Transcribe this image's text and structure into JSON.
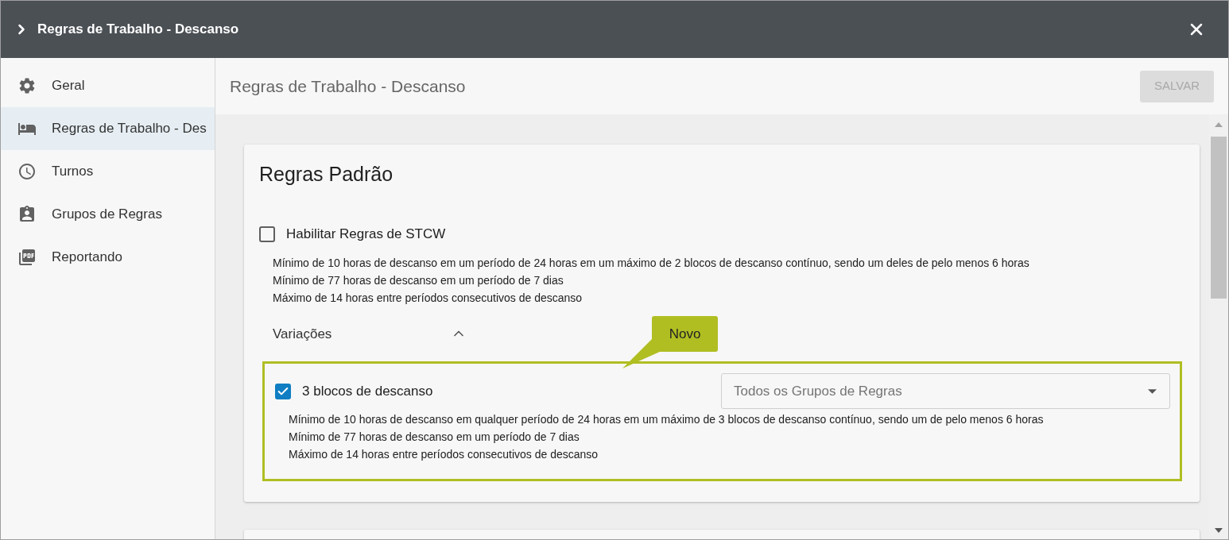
{
  "window": {
    "title": "Regras de Trabalho - Descanso"
  },
  "sidebar": {
    "items": [
      {
        "label": "Geral",
        "selected": false
      },
      {
        "label": "Regras de Trabalho - Des",
        "selected": true
      },
      {
        "label": "Turnos",
        "selected": false
      },
      {
        "label": "Grupos de Regras",
        "selected": false
      },
      {
        "label": "Reportando",
        "selected": false
      }
    ]
  },
  "page": {
    "title": "Regras de Trabalho - Descanso",
    "save_button": {
      "label": "SALVAR",
      "disabled": true
    }
  },
  "card": {
    "title": "Regras Padrão",
    "main_rule": {
      "label": "Habilitar Regras de STCW",
      "checked": false,
      "lines": [
        "Mínimo de 10 horas de descanso em um período de 24 horas em um máximo de 2 blocos de descanso contínuo, sendo um deles de pelo menos 6 horas",
        "Mínimo de 77 horas de descanso em um período de 7 dias",
        "Máximo de 14 horas entre períodos consecutivos de descanso"
      ]
    },
    "variations": {
      "label": "Variações",
      "expanded": true,
      "items": [
        {
          "label": "3 blocos de descanso",
          "checked": true,
          "dropdown": {
            "value": "Todos os Grupos de Regras"
          },
          "lines": [
            "Mínimo de 10 horas de descanso em qualquer período de 24 horas em um máximo de 3 blocos de descanso contínuo, sendo um de pelo menos 6 horas",
            "Mínimo de 77 horas de descanso em um período de 7 dias",
            "Máximo de 14 horas entre períodos consecutivos de descanso"
          ]
        }
      ]
    }
  },
  "callout": {
    "label": "Novo"
  }
}
